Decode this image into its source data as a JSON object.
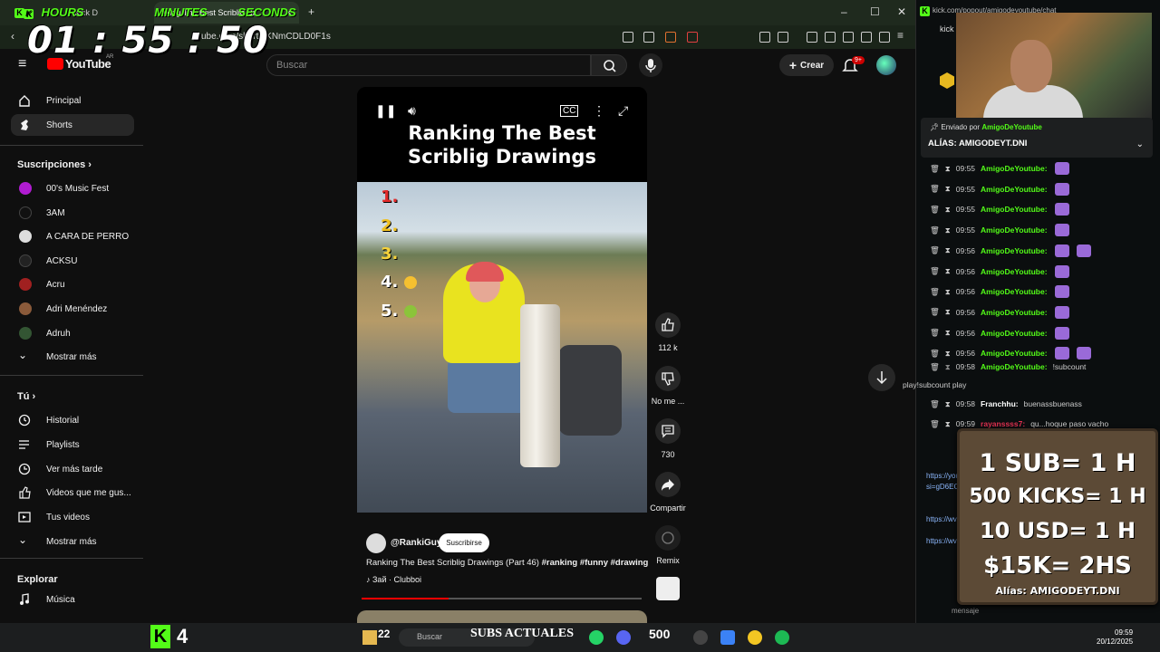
{
  "timer": {
    "hours_label": "HOURS",
    "minutes_label": "MINUTES",
    "seconds_label": "SECONDS",
    "display": "01 : 55 : 50"
  },
  "browser": {
    "tab1_title": "Kick D",
    "tab2_title": "nking The Best Scriblig Dr",
    "url": "ube.com/shorts/KNmCDLD0F1s"
  },
  "youtube": {
    "logo": "YouTube",
    "logo_region": "AR",
    "search_placeholder": "Buscar",
    "create_label": "Crear",
    "notif_count": "9+"
  },
  "sidebar": {
    "main": [
      {
        "label": "Principal",
        "icon": "home-icon"
      },
      {
        "label": "Shorts",
        "icon": "shorts-icon",
        "active": true
      }
    ],
    "subs_heading": "Suscripciones",
    "subscriptions": [
      {
        "label": "00's Music Fest",
        "color": "#b01cd1"
      },
      {
        "label": "3AM",
        "color": "#111111"
      },
      {
        "label": "A CARA DE PERRO",
        "color": "#dddddd"
      },
      {
        "label": "ACKSU",
        "color": "#222222"
      },
      {
        "label": "Acru",
        "color": "#a02020"
      },
      {
        "label": "Adri Menéndez",
        "color": "#8a5a3a"
      },
      {
        "label": "Adruh",
        "color": "#335533"
      }
    ],
    "show_more_1": "Mostrar más",
    "you_heading": "Tú",
    "you": [
      {
        "label": "Historial",
        "icon": "history-icon"
      },
      {
        "label": "Playlists",
        "icon": "playlists-icon"
      },
      {
        "label": "Ver más tarde",
        "icon": "watch-later-icon"
      },
      {
        "label": "Videos que me gus...",
        "icon": "liked-icon"
      },
      {
        "label": "Tus videos",
        "icon": "your-videos-icon"
      }
    ],
    "show_more_2": "Mostrar más",
    "explore_heading": "Explorar",
    "explore": [
      {
        "label": "Música",
        "icon": "music-icon"
      }
    ]
  },
  "video": {
    "headline": "Ranking The Best Scriblig Drawings",
    "ranks": [
      "1.",
      "2.",
      "3.",
      "4.",
      "5."
    ],
    "rank_colors": [
      "#e22b2b",
      "#f0c020",
      "#f6d23a",
      "#ffffff",
      "#ffffff"
    ],
    "progress_fraction": 0.31
  },
  "actions": {
    "likes": "112 k",
    "dislike": "No me ...",
    "comments": "730",
    "share": "Compartir",
    "remix": "Remix"
  },
  "meta": {
    "channel": "@RankiGuy",
    "subscribe": "Suscribirse",
    "description": "Ranking The Best Scriblig Drawings (Part 46)",
    "hashtags": "#ranking #funny #drawing",
    "music": "♪ Зай · Clubboi"
  },
  "chat": {
    "url": "kick.com/popout/amigodeyoutube/chat",
    "header": "kick",
    "pinned_from_label": "Enviado por",
    "pinned_user": "AmigoDeYoutube",
    "pinned_alias": "ALÍAS: AMIGODEYT.DNI",
    "rows": [
      {
        "time": "09:55",
        "user": "AmigoDeYoutube:",
        "emotes": 1
      },
      {
        "time": "09:55",
        "user": "AmigoDeYoutube:",
        "emotes": 1
      },
      {
        "time": "09:55",
        "user": "AmigoDeYoutube:",
        "emotes": 1
      },
      {
        "time": "09:55",
        "user": "AmigoDeYoutube:",
        "emotes": 1
      },
      {
        "time": "09:56",
        "user": "AmigoDeYoutube:",
        "emotes": 2
      },
      {
        "time": "09:56",
        "user": "AmigoDeYoutube:",
        "emotes": 1
      },
      {
        "time": "09:56",
        "user": "AmigoDeYoutube:",
        "emotes": 1
      },
      {
        "time": "09:56",
        "user": "AmigoDeYoutube:",
        "emotes": 1
      },
      {
        "time": "09:56",
        "user": "AmigoDeYoutube:",
        "emotes": 1
      },
      {
        "time": "09:56",
        "user": "AmigoDeYoutube:",
        "emotes": 2
      }
    ],
    "subcount_time": "09:58",
    "subcount_user": "AmigoDeYoutube:",
    "subcount_text": "!subcount",
    "subcount_text2": "play!subcount play",
    "franchhu_time": "09:58",
    "franchhu_user": "Franchhu:",
    "franchhu_text": "buenassbuenass",
    "rayan_time": "09:59",
    "rayan_user": "rayanssss7:",
    "rayan_text": "qu...hoque paso vacho",
    "link1": "https://youtub...",
    "link1b": "si=gD6EC...",
    "link2": "https://wv...",
    "link3": "https://wv...",
    "input_placeholder": "mensaje"
  },
  "sign": {
    "line1": "1 SUB= 1 H",
    "line2": "500 KICKS= 1 H",
    "line3": "10 USD= 1 H",
    "line4": "$15K= 2HS",
    "alias": "Alías: AMIGODEYT.DNI"
  },
  "taskbar": {
    "kick_count": "4",
    "num_22": "22",
    "search": "Buscar",
    "subs_label": "SUBS ACTUALES",
    "subs_count": "500",
    "time": "09:59",
    "date": "20/12/2025"
  }
}
